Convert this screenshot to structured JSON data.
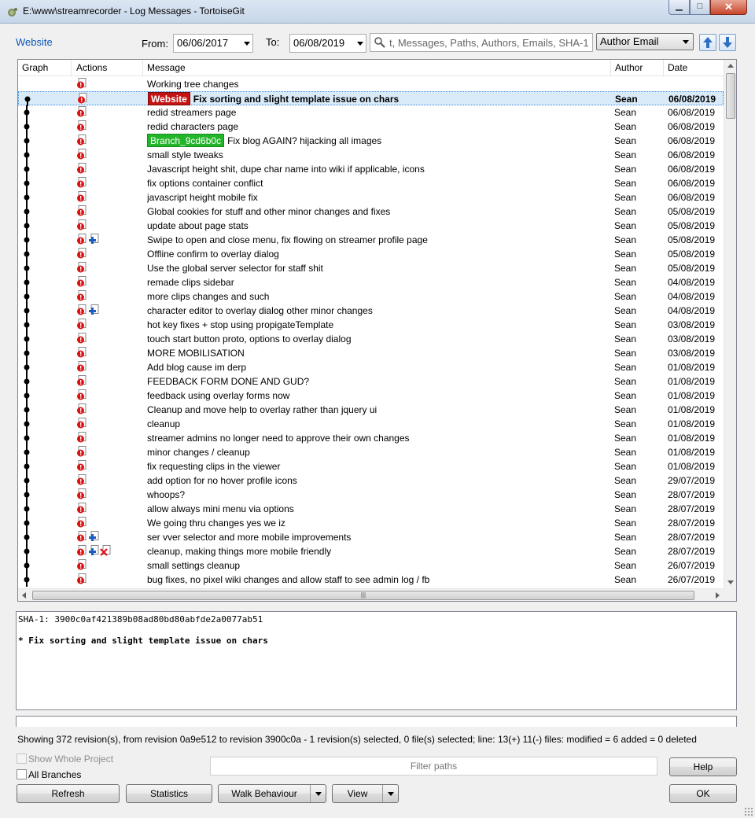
{
  "window": {
    "title": "E:\\www\\streamrecorder - Log Messages - TortoiseGit",
    "min_glyph": "▁",
    "max_glyph": "□",
    "close_glyph": "✕"
  },
  "toolbar": {
    "ref_link": "Website",
    "from_label": "From:",
    "from_value": "06/06/2017",
    "to_label": "To:",
    "to_value": "06/08/2019",
    "search_placeholder": "t, Messages, Paths, Authors, Emails, SHA-1",
    "search_icon": "magnifier-icon",
    "filter_by": "Author Email"
  },
  "columns": [
    "Graph",
    "Actions",
    "Message",
    "Author",
    "Date"
  ],
  "rows": [
    {
      "tags": [],
      "message": "Working tree changes",
      "author": "",
      "date": "",
      "actions": [
        "modified"
      ],
      "graph": false
    },
    {
      "tags": [
        {
          "text": "Website",
          "color": "red"
        }
      ],
      "message": "Fix sorting and slight template issue on chars",
      "author": "Sean",
      "date": "06/08/2019",
      "actions": [
        "modified"
      ],
      "graph": true,
      "selected": true
    },
    {
      "tags": [],
      "message": "redid streamers page",
      "author": "Sean",
      "date": "06/08/2019",
      "actions": [
        "modified"
      ],
      "graph": true
    },
    {
      "tags": [],
      "message": "redid characters page",
      "author": "Sean",
      "date": "06/08/2019",
      "actions": [
        "modified"
      ],
      "graph": true
    },
    {
      "tags": [
        {
          "text": "Branch_9cd6b0c",
          "color": "green"
        }
      ],
      "message": "Fix blog AGAIN? hijacking all images",
      "author": "Sean",
      "date": "06/08/2019",
      "actions": [
        "modified"
      ],
      "graph": true
    },
    {
      "tags": [],
      "message": "small style tweaks",
      "author": "Sean",
      "date": "06/08/2019",
      "actions": [
        "modified"
      ],
      "graph": true
    },
    {
      "tags": [],
      "message": "Javascript height shit, dupe char name into wiki if applicable, icons",
      "author": "Sean",
      "date": "06/08/2019",
      "actions": [
        "modified"
      ],
      "graph": true
    },
    {
      "tags": [],
      "message": "fix options container conflict",
      "author": "Sean",
      "date": "06/08/2019",
      "actions": [
        "modified"
      ],
      "graph": true
    },
    {
      "tags": [],
      "message": "javascript height mobile fix",
      "author": "Sean",
      "date": "06/08/2019",
      "actions": [
        "modified"
      ],
      "graph": true
    },
    {
      "tags": [],
      "message": "Global cookies for stuff and other minor changes and fixes",
      "author": "Sean",
      "date": "05/08/2019",
      "actions": [
        "modified"
      ],
      "graph": true
    },
    {
      "tags": [],
      "message": "update about page stats",
      "author": "Sean",
      "date": "05/08/2019",
      "actions": [
        "modified"
      ],
      "graph": true
    },
    {
      "tags": [],
      "message": "Swipe to open and close menu, fix flowing on streamer profile page",
      "author": "Sean",
      "date": "05/08/2019",
      "actions": [
        "modified",
        "added"
      ],
      "graph": true
    },
    {
      "tags": [],
      "message": "Offline confirm to overlay dialog",
      "author": "Sean",
      "date": "05/08/2019",
      "actions": [
        "modified"
      ],
      "graph": true
    },
    {
      "tags": [],
      "message": "Use the global server selector for staff shit",
      "author": "Sean",
      "date": "05/08/2019",
      "actions": [
        "modified"
      ],
      "graph": true
    },
    {
      "tags": [],
      "message": "remade clips sidebar",
      "author": "Sean",
      "date": "04/08/2019",
      "actions": [
        "modified"
      ],
      "graph": true
    },
    {
      "tags": [],
      "message": "more clips changes and such",
      "author": "Sean",
      "date": "04/08/2019",
      "actions": [
        "modified"
      ],
      "graph": true
    },
    {
      "tags": [],
      "message": "character editor to overlay dialog other minor changes",
      "author": "Sean",
      "date": "04/08/2019",
      "actions": [
        "modified",
        "added"
      ],
      "graph": true
    },
    {
      "tags": [],
      "message": "hot key fixes + stop using propigateTemplate",
      "author": "Sean",
      "date": "03/08/2019",
      "actions": [
        "modified"
      ],
      "graph": true
    },
    {
      "tags": [],
      "message": "touch start button proto, options to overlay dialog",
      "author": "Sean",
      "date": "03/08/2019",
      "actions": [
        "modified"
      ],
      "graph": true
    },
    {
      "tags": [],
      "message": "MORE MOBILISATION",
      "author": "Sean",
      "date": "03/08/2019",
      "actions": [
        "modified"
      ],
      "graph": true
    },
    {
      "tags": [],
      "message": "Add blog cause im derp",
      "author": "Sean",
      "date": "01/08/2019",
      "actions": [
        "modified"
      ],
      "graph": true
    },
    {
      "tags": [],
      "message": "FEEDBACK FORM DONE AND GUD?",
      "author": "Sean",
      "date": "01/08/2019",
      "actions": [
        "modified"
      ],
      "graph": true
    },
    {
      "tags": [],
      "message": "feedback using overlay forms now",
      "author": "Sean",
      "date": "01/08/2019",
      "actions": [
        "modified"
      ],
      "graph": true
    },
    {
      "tags": [],
      "message": "Cleanup and move help to overlay rather than jquery ui",
      "author": "Sean",
      "date": "01/08/2019",
      "actions": [
        "modified"
      ],
      "graph": true
    },
    {
      "tags": [],
      "message": "cleanup",
      "author": "Sean",
      "date": "01/08/2019",
      "actions": [
        "modified"
      ],
      "graph": true
    },
    {
      "tags": [],
      "message": "streamer admins no longer need to approve their own changes",
      "author": "Sean",
      "date": "01/08/2019",
      "actions": [
        "modified"
      ],
      "graph": true
    },
    {
      "tags": [],
      "message": "minor changes / cleanup",
      "author": "Sean",
      "date": "01/08/2019",
      "actions": [
        "modified"
      ],
      "graph": true
    },
    {
      "tags": [],
      "message": "fix requesting clips in the viewer",
      "author": "Sean",
      "date": "01/08/2019",
      "actions": [
        "modified"
      ],
      "graph": true
    },
    {
      "tags": [],
      "message": "add option for no hover profile icons",
      "author": "Sean",
      "date": "29/07/2019",
      "actions": [
        "modified"
      ],
      "graph": true
    },
    {
      "tags": [],
      "message": "whoops?",
      "author": "Sean",
      "date": "28/07/2019",
      "actions": [
        "modified"
      ],
      "graph": true
    },
    {
      "tags": [],
      "message": "allow always mini menu via options",
      "author": "Sean",
      "date": "28/07/2019",
      "actions": [
        "modified"
      ],
      "graph": true
    },
    {
      "tags": [],
      "message": "We going thru changes yes we iz",
      "author": "Sean",
      "date": "28/07/2019",
      "actions": [
        "modified"
      ],
      "graph": true
    },
    {
      "tags": [],
      "message": "ser vver selector and more mobile improvements",
      "author": "Sean",
      "date": "28/07/2019",
      "actions": [
        "modified",
        "added"
      ],
      "graph": true
    },
    {
      "tags": [],
      "message": "cleanup, making things more mobile friendly",
      "author": "Sean",
      "date": "28/07/2019",
      "actions": [
        "modified",
        "added",
        "deleted"
      ],
      "graph": true
    },
    {
      "tags": [],
      "message": "small settings cleanup",
      "author": "Sean",
      "date": "26/07/2019",
      "actions": [
        "modified"
      ],
      "graph": true
    },
    {
      "tags": [],
      "message": "bug fixes, no pixel wiki changes and allow staff to see admin log / fb",
      "author": "Sean",
      "date": "26/07/2019",
      "actions": [
        "modified"
      ],
      "graph": true
    }
  ],
  "details": {
    "sha_line": "SHA-1: 3900c0af421389b08ad80bd80abfde2a0077ab51",
    "message": "* Fix sorting and slight template issue on chars"
  },
  "status_text": "Showing 372 revision(s), from revision 0a9e512 to revision 3900c0a - 1 revision(s) selected, 0 file(s) selected; line: 13(+) 11(-) files: modified = 6 added = 0 deleted",
  "options": {
    "show_whole_project": "Show Whole Project",
    "all_branches": "All Branches",
    "filter_paths_placeholder": "Filter paths"
  },
  "buttons": {
    "help": "Help",
    "refresh": "Refresh",
    "statistics": "Statistics",
    "walk_behaviour": "Walk Behaviour",
    "view": "View",
    "ok": "OK"
  },
  "colors": {
    "tag_red": "#c41313",
    "tag_green": "#22b52a",
    "selection": "#d9ebf9",
    "link": "#0b57b8"
  }
}
